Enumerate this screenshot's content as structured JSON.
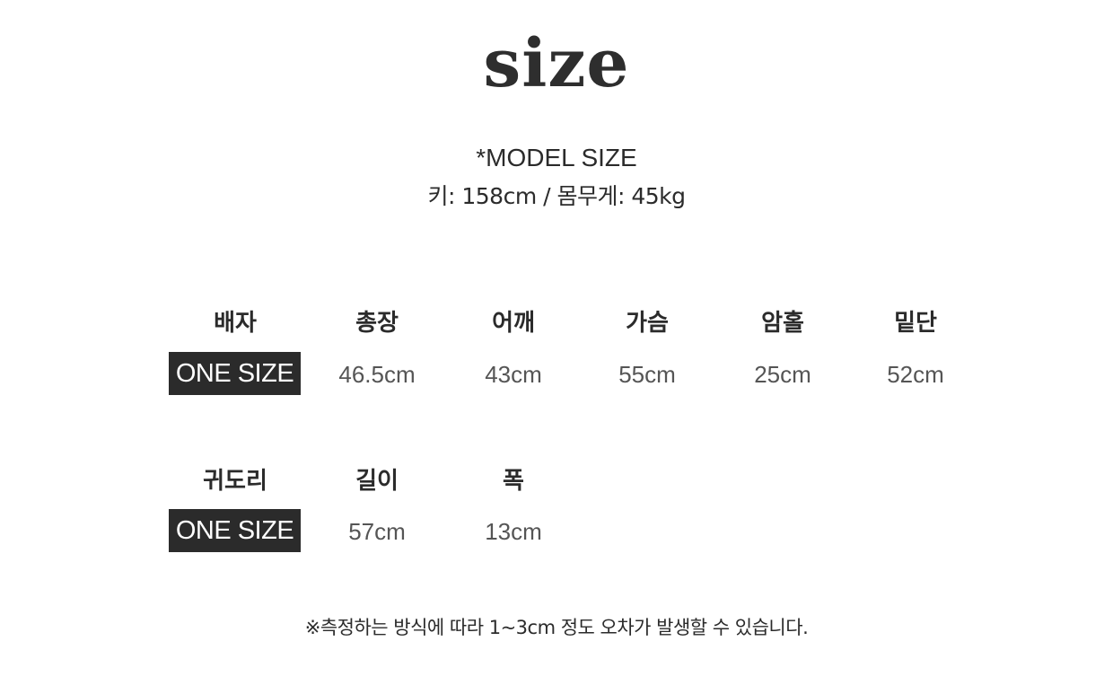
{
  "title": "size",
  "model": {
    "label": "*MODEL SIZE",
    "stats": "키: 158cm / 몸무게: 45kg"
  },
  "badge_text": "ONE SIZE",
  "table1": {
    "headers": [
      "배자",
      "총장",
      "어깨",
      "가슴",
      "암홀",
      "밑단"
    ],
    "values": [
      "46.5cm",
      "43cm",
      "55cm",
      "25cm",
      "52cm"
    ]
  },
  "table2": {
    "headers": [
      "귀도리",
      "길이",
      "폭"
    ],
    "values": [
      "57cm",
      "13cm"
    ]
  },
  "note": "※측정하는 방식에 따라 1~3cm 정도 오차가 발생할 수 있습니다.",
  "colors": {
    "badge_bg": "#2b2b2b",
    "text": "#2b2b2b",
    "value_text": "#555555"
  }
}
